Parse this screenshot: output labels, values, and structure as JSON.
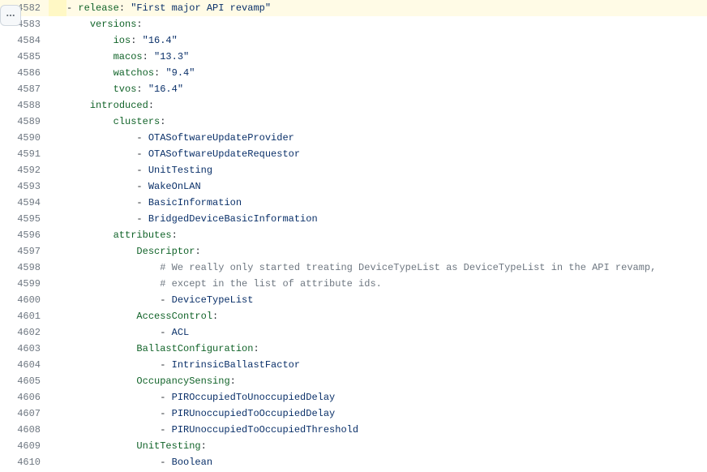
{
  "more_button": {
    "name": "more-button",
    "label": "..."
  },
  "lines": [
    {
      "n": 4582,
      "highlight": true,
      "marker": "",
      "segments": [
        {
          "cls": "tok-dash",
          "t": "- "
        },
        {
          "cls": "tok-key",
          "t": "release"
        },
        {
          "cls": "tok-punct",
          "t": ": "
        },
        {
          "cls": "tok-str",
          "t": "\"First major API revamp\""
        }
      ]
    },
    {
      "n": 4583,
      "segments": [
        {
          "cls": "",
          "t": "    "
        },
        {
          "cls": "tok-key",
          "t": "versions"
        },
        {
          "cls": "tok-punct",
          "t": ":"
        }
      ]
    },
    {
      "n": 4584,
      "segments": [
        {
          "cls": "",
          "t": "        "
        },
        {
          "cls": "tok-key",
          "t": "ios"
        },
        {
          "cls": "tok-punct",
          "t": ": "
        },
        {
          "cls": "tok-str",
          "t": "\"16.4\""
        }
      ]
    },
    {
      "n": 4585,
      "segments": [
        {
          "cls": "",
          "t": "        "
        },
        {
          "cls": "tok-key",
          "t": "macos"
        },
        {
          "cls": "tok-punct",
          "t": ": "
        },
        {
          "cls": "tok-str",
          "t": "\"13.3\""
        }
      ]
    },
    {
      "n": 4586,
      "segments": [
        {
          "cls": "",
          "t": "        "
        },
        {
          "cls": "tok-key",
          "t": "watchos"
        },
        {
          "cls": "tok-punct",
          "t": ": "
        },
        {
          "cls": "tok-str",
          "t": "\"9.4\""
        }
      ]
    },
    {
      "n": 4587,
      "segments": [
        {
          "cls": "",
          "t": "        "
        },
        {
          "cls": "tok-key",
          "t": "tvos"
        },
        {
          "cls": "tok-punct",
          "t": ": "
        },
        {
          "cls": "tok-str",
          "t": "\"16.4\""
        }
      ]
    },
    {
      "n": 4588,
      "segments": [
        {
          "cls": "",
          "t": "    "
        },
        {
          "cls": "tok-key",
          "t": "introduced"
        },
        {
          "cls": "tok-punct",
          "t": ":"
        }
      ]
    },
    {
      "n": 4589,
      "segments": [
        {
          "cls": "",
          "t": "        "
        },
        {
          "cls": "tok-key",
          "t": "clusters"
        },
        {
          "cls": "tok-punct",
          "t": ":"
        }
      ]
    },
    {
      "n": 4590,
      "segments": [
        {
          "cls": "",
          "t": "            "
        },
        {
          "cls": "tok-dash",
          "t": "- "
        },
        {
          "cls": "tok-item",
          "t": "OTASoftwareUpdateProvider"
        }
      ]
    },
    {
      "n": 4591,
      "segments": [
        {
          "cls": "",
          "t": "            "
        },
        {
          "cls": "tok-dash",
          "t": "- "
        },
        {
          "cls": "tok-item",
          "t": "OTASoftwareUpdateRequestor"
        }
      ]
    },
    {
      "n": 4592,
      "segments": [
        {
          "cls": "",
          "t": "            "
        },
        {
          "cls": "tok-dash",
          "t": "- "
        },
        {
          "cls": "tok-item",
          "t": "UnitTesting"
        }
      ]
    },
    {
      "n": 4593,
      "segments": [
        {
          "cls": "",
          "t": "            "
        },
        {
          "cls": "tok-dash",
          "t": "- "
        },
        {
          "cls": "tok-item",
          "t": "WakeOnLAN"
        }
      ]
    },
    {
      "n": 4594,
      "segments": [
        {
          "cls": "",
          "t": "            "
        },
        {
          "cls": "tok-dash",
          "t": "- "
        },
        {
          "cls": "tok-item",
          "t": "BasicInformation"
        }
      ]
    },
    {
      "n": 4595,
      "segments": [
        {
          "cls": "",
          "t": "            "
        },
        {
          "cls": "tok-dash",
          "t": "- "
        },
        {
          "cls": "tok-item",
          "t": "BridgedDeviceBasicInformation"
        }
      ]
    },
    {
      "n": 4596,
      "segments": [
        {
          "cls": "",
          "t": "        "
        },
        {
          "cls": "tok-key",
          "t": "attributes"
        },
        {
          "cls": "tok-punct",
          "t": ":"
        }
      ]
    },
    {
      "n": 4597,
      "segments": [
        {
          "cls": "",
          "t": "            "
        },
        {
          "cls": "tok-key",
          "t": "Descriptor"
        },
        {
          "cls": "tok-punct",
          "t": ":"
        }
      ]
    },
    {
      "n": 4598,
      "segments": [
        {
          "cls": "",
          "t": "                "
        },
        {
          "cls": "tok-cmt",
          "t": "# We really only started treating DeviceTypeList as DeviceTypeList in the API revamp,"
        }
      ]
    },
    {
      "n": 4599,
      "segments": [
        {
          "cls": "",
          "t": "                "
        },
        {
          "cls": "tok-cmt",
          "t": "# except in the list of attribute ids."
        }
      ]
    },
    {
      "n": 4600,
      "segments": [
        {
          "cls": "",
          "t": "                "
        },
        {
          "cls": "tok-dash",
          "t": "- "
        },
        {
          "cls": "tok-item",
          "t": "DeviceTypeList"
        }
      ]
    },
    {
      "n": 4601,
      "segments": [
        {
          "cls": "",
          "t": "            "
        },
        {
          "cls": "tok-key",
          "t": "AccessControl"
        },
        {
          "cls": "tok-punct",
          "t": ":"
        }
      ]
    },
    {
      "n": 4602,
      "segments": [
        {
          "cls": "",
          "t": "                "
        },
        {
          "cls": "tok-dash",
          "t": "- "
        },
        {
          "cls": "tok-item",
          "t": "ACL"
        }
      ]
    },
    {
      "n": 4603,
      "segments": [
        {
          "cls": "",
          "t": "            "
        },
        {
          "cls": "tok-key",
          "t": "BallastConfiguration"
        },
        {
          "cls": "tok-punct",
          "t": ":"
        }
      ]
    },
    {
      "n": 4604,
      "segments": [
        {
          "cls": "",
          "t": "                "
        },
        {
          "cls": "tok-dash",
          "t": "- "
        },
        {
          "cls": "tok-item",
          "t": "IntrinsicBallastFactor"
        }
      ]
    },
    {
      "n": 4605,
      "segments": [
        {
          "cls": "",
          "t": "            "
        },
        {
          "cls": "tok-key",
          "t": "OccupancySensing"
        },
        {
          "cls": "tok-punct",
          "t": ":"
        }
      ]
    },
    {
      "n": 4606,
      "segments": [
        {
          "cls": "",
          "t": "                "
        },
        {
          "cls": "tok-dash",
          "t": "- "
        },
        {
          "cls": "tok-item",
          "t": "PIROccupiedToUnoccupiedDelay"
        }
      ]
    },
    {
      "n": 4607,
      "segments": [
        {
          "cls": "",
          "t": "                "
        },
        {
          "cls": "tok-dash",
          "t": "- "
        },
        {
          "cls": "tok-item",
          "t": "PIRUnoccupiedToOccupiedDelay"
        }
      ]
    },
    {
      "n": 4608,
      "segments": [
        {
          "cls": "",
          "t": "                "
        },
        {
          "cls": "tok-dash",
          "t": "- "
        },
        {
          "cls": "tok-item",
          "t": "PIRUnoccupiedToOccupiedThreshold"
        }
      ]
    },
    {
      "n": 4609,
      "segments": [
        {
          "cls": "",
          "t": "            "
        },
        {
          "cls": "tok-key",
          "t": "UnitTesting"
        },
        {
          "cls": "tok-punct",
          "t": ":"
        }
      ]
    },
    {
      "n": 4610,
      "segments": [
        {
          "cls": "",
          "t": "                "
        },
        {
          "cls": "tok-dash",
          "t": "- "
        },
        {
          "cls": "tok-item",
          "t": "Boolean"
        }
      ]
    }
  ]
}
